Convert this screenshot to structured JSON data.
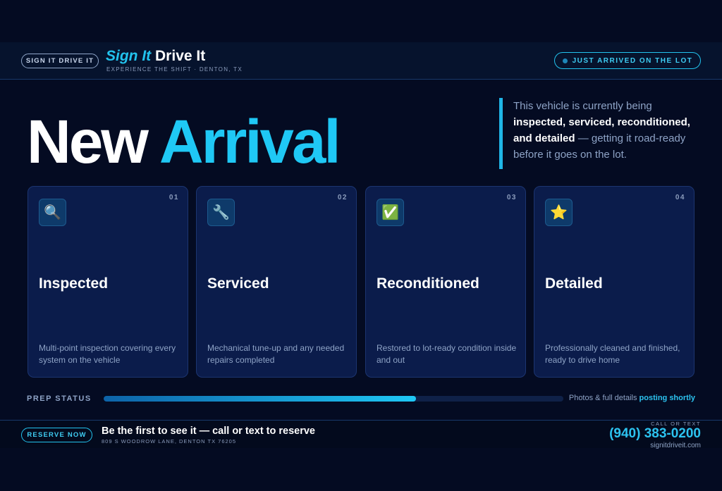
{
  "header": {
    "brand_pill": "SIGN IT DRIVE IT",
    "title_accent": "Sign It",
    "title_rest": "Drive It",
    "subtitle": "EXPERIENCE THE SHIFT · DENTON, TX",
    "status_label": "JUST ARRIVED ON THE LOT"
  },
  "hero": {
    "title_main": "New",
    "title_accent": "Arrival",
    "note_lead": "This vehicle is currently being",
    "note_bold": "inspected, serviced, reconditioned, and detailed",
    "note_tail": "— getting it road-ready before it goes on the lot."
  },
  "cards": [
    {
      "number": "01",
      "icon": "🔍",
      "icon_name": "magnifier-icon",
      "title": "Inspected",
      "description": "Multi-point inspection covering every system on the vehicle"
    },
    {
      "number": "02",
      "icon": "🔧",
      "icon_name": "wrench-icon",
      "title": "Serviced",
      "description": "Mechanical tune-up and any needed repairs completed"
    },
    {
      "number": "03",
      "icon": "✅",
      "icon_name": "check-icon",
      "title": "Reconditioned",
      "description": "Restored to lot-ready condition inside and out"
    },
    {
      "number": "04",
      "icon": "⭐",
      "icon_name": "star-icon",
      "title": "Detailed",
      "description": "Professionally cleaned and finished, ready to drive home"
    }
  ],
  "prep": {
    "label": "PREP STATUS",
    "progress": 0.68,
    "note_lead": "Photos & full details",
    "note_accent": "posting shortly"
  },
  "footer": {
    "reserve_label": "RESERVE NOW",
    "headline": "Be the first to see it — call or text to reserve",
    "address": "809 S WOODROW LANE, DENTON TX 76205",
    "contact_label": "CALL OR TEXT",
    "phone": "(940) 383-0200",
    "website": "signitdriveit.com"
  },
  "colors": {
    "background": "#040b22",
    "accent": "#1fc8f5",
    "card": "#0b1c4b",
    "muted_text": "#8ea3c6"
  }
}
